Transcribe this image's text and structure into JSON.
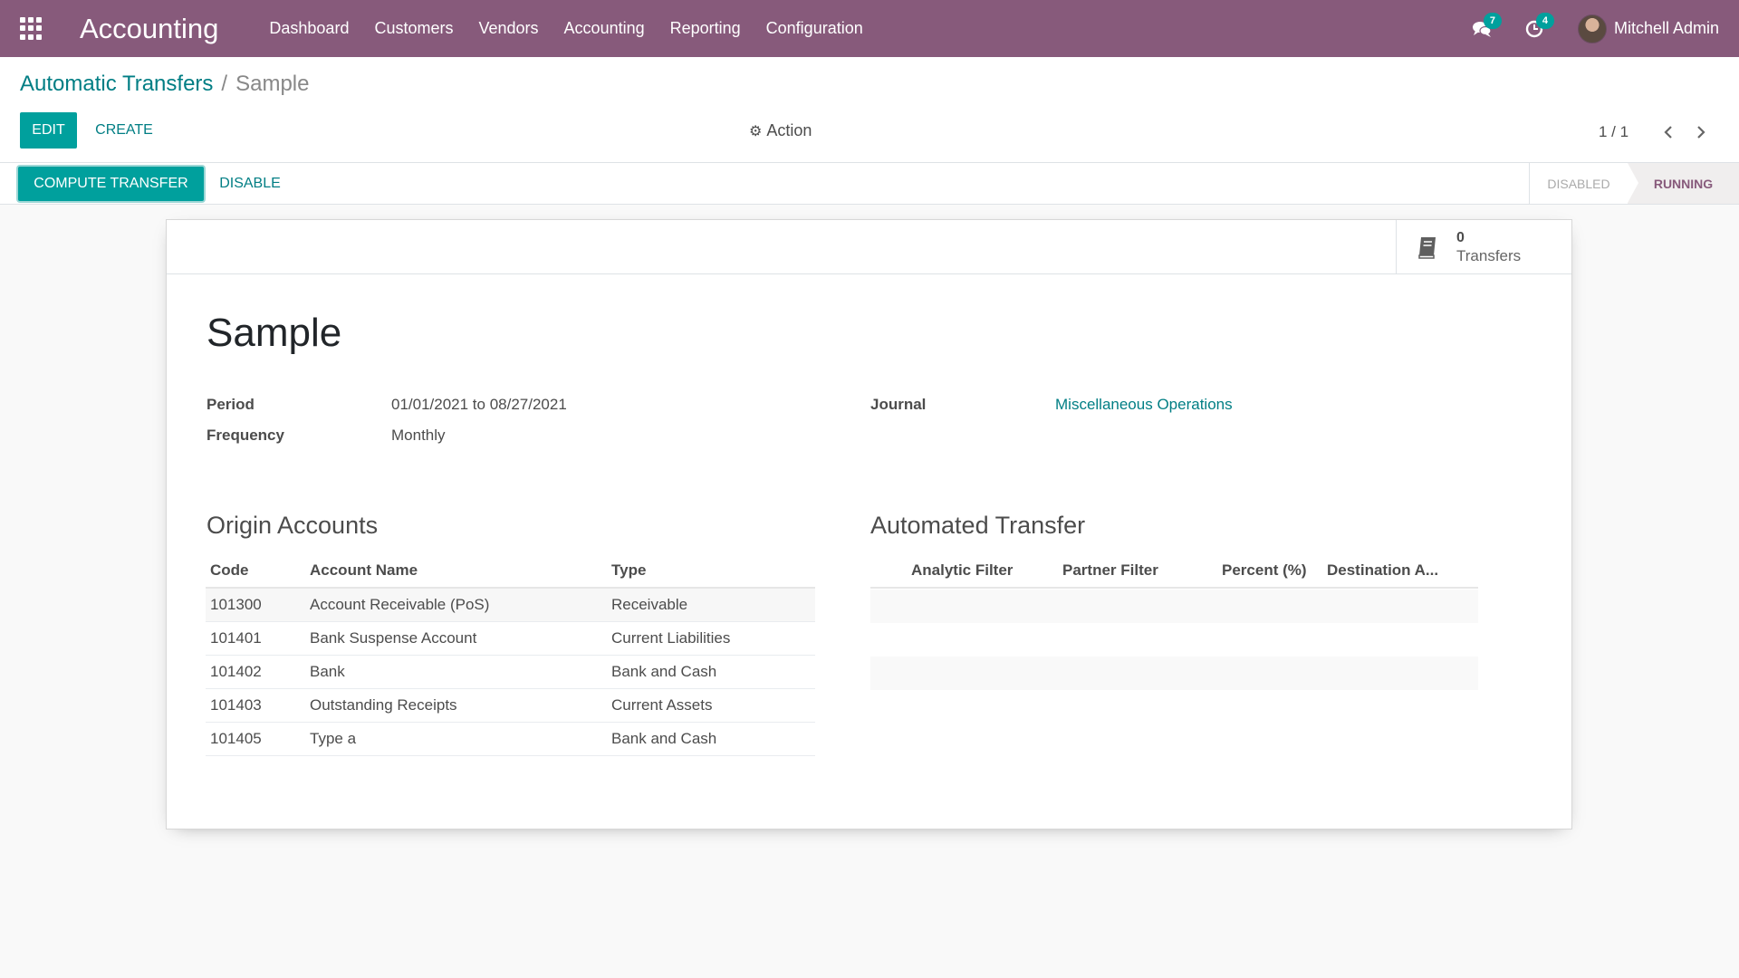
{
  "navbar": {
    "app_title": "Accounting",
    "menu": [
      "Dashboard",
      "Customers",
      "Vendors",
      "Accounting",
      "Reporting",
      "Configuration"
    ],
    "messages_count": "7",
    "activities_count": "4",
    "user_name": "Mitchell Admin",
    "bg_color": "#875a7b"
  },
  "breadcrumb": {
    "parent": "Automatic Transfers",
    "separator": "/",
    "current": "Sample"
  },
  "toolbar": {
    "edit_label": "EDIT",
    "create_label": "CREATE",
    "action_label": "Action",
    "pager": "1 / 1"
  },
  "statusbar": {
    "compute_label": "COMPUTE TRANSFER",
    "disable_label": "DISABLE",
    "steps": [
      "DISABLED",
      "RUNNING"
    ],
    "active_step": "RUNNING"
  },
  "smart_button": {
    "value": "0",
    "label": "Transfers",
    "icon": "book-icon"
  },
  "record": {
    "name": "Sample",
    "period_label": "Period",
    "period_value": "01/01/2021 to 08/27/2021",
    "frequency_label": "Frequency",
    "frequency_value": "Monthly",
    "journal_label": "Journal",
    "journal_value": "Miscellaneous Operations"
  },
  "origin_accounts": {
    "title": "Origin Accounts",
    "columns": [
      "Code",
      "Account Name",
      "Type"
    ],
    "rows": [
      [
        "101300",
        "Account Receivable (PoS)",
        "Receivable"
      ],
      [
        "101401",
        "Bank Suspense Account",
        "Current Liabilities"
      ],
      [
        "101402",
        "Bank",
        "Bank and Cash"
      ],
      [
        "101403",
        "Outstanding Receipts",
        "Current Assets"
      ],
      [
        "101405",
        "Type a",
        "Bank and Cash"
      ]
    ]
  },
  "automated_transfer": {
    "title": "Automated Transfer",
    "columns": [
      "Analytic Filter",
      "Partner Filter",
      "Percent (%)",
      "Destination A..."
    ]
  },
  "colors": {
    "accent": "#00a09d",
    "link": "#017e84",
    "brand": "#875a7b"
  }
}
